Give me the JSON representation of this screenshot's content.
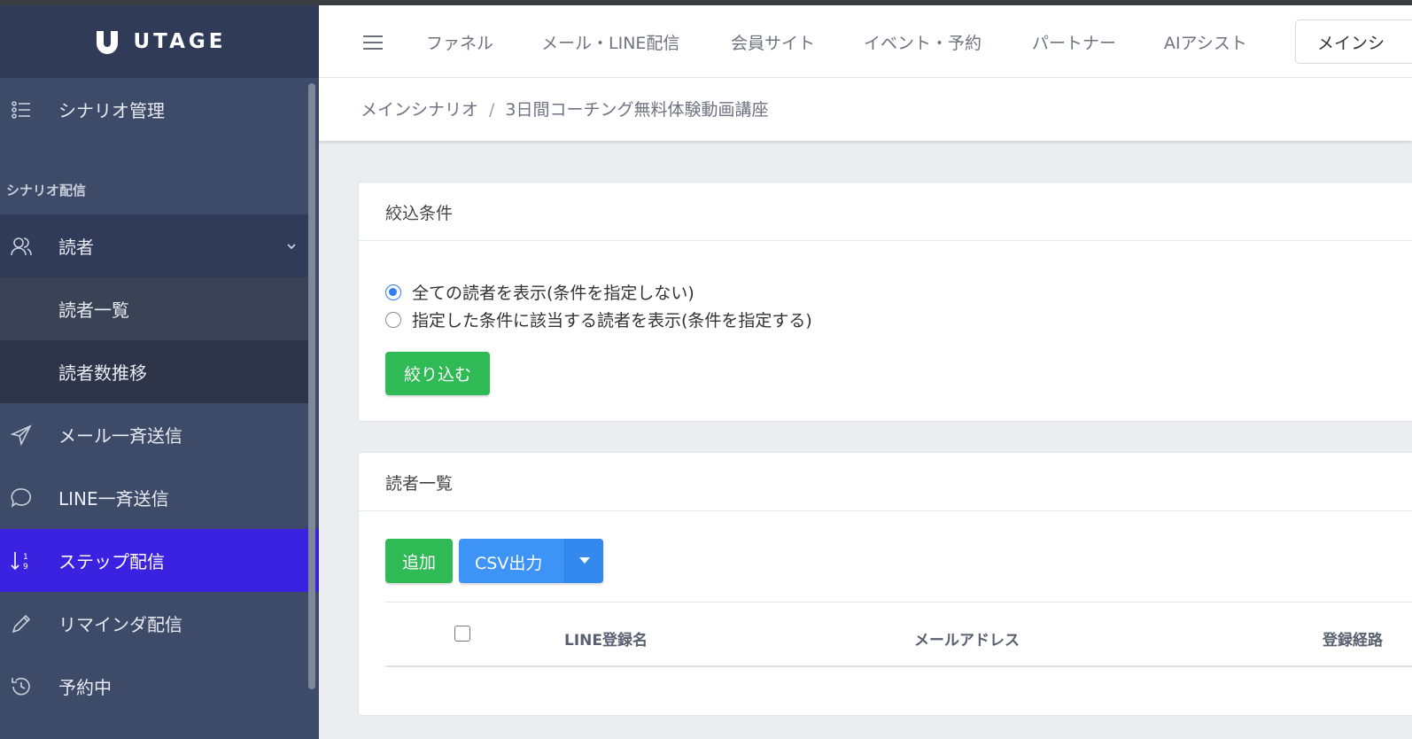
{
  "brand": {
    "name": "UTAGE"
  },
  "sidebar": {
    "section_label": "シナリオ配信",
    "items": [
      {
        "label": "シナリオ管理",
        "icon": "list-icon"
      },
      {
        "label": "読者",
        "icon": "users-icon"
      },
      {
        "label": "読者一覧"
      },
      {
        "label": "読者数推移"
      },
      {
        "label": "メール一斉送信",
        "icon": "send-icon"
      },
      {
        "label": "LINE一斉送信",
        "icon": "chat-icon"
      },
      {
        "label": "ステップ配信",
        "icon": "sort-numeric-icon",
        "active": true
      },
      {
        "label": "リマインダ配信",
        "icon": "pencil-icon"
      },
      {
        "label": "予約中",
        "icon": "history-icon"
      }
    ]
  },
  "topnav": {
    "items": [
      "ファネル",
      "メール・LINE配信",
      "会員サイト",
      "イベント・予約",
      "パートナー",
      "AIアシスト"
    ],
    "scenario_select": "メインシ"
  },
  "breadcrumb": {
    "parent": "メインシナリオ",
    "separator": "/",
    "current": "3日間コーチング無料体験動画講座"
  },
  "filter_card": {
    "title": "絞込条件",
    "option_all": "全ての読者を表示(条件を指定しない)",
    "option_conditional": "指定した条件に該当する読者を表示(条件を指定する)",
    "selected": "all",
    "apply_label": "絞り込む"
  },
  "readers_card": {
    "title": "読者一覧",
    "add_label": "追加",
    "csv_label": "CSV出力",
    "columns": [
      "LINE登録名",
      "メールアドレス",
      "登録経路"
    ]
  },
  "colors": {
    "sidebar_bg": "#3d4a68",
    "active_item": "#3b22e0",
    "primary_green": "#2fba55",
    "primary_blue": "#3d94f6"
  }
}
